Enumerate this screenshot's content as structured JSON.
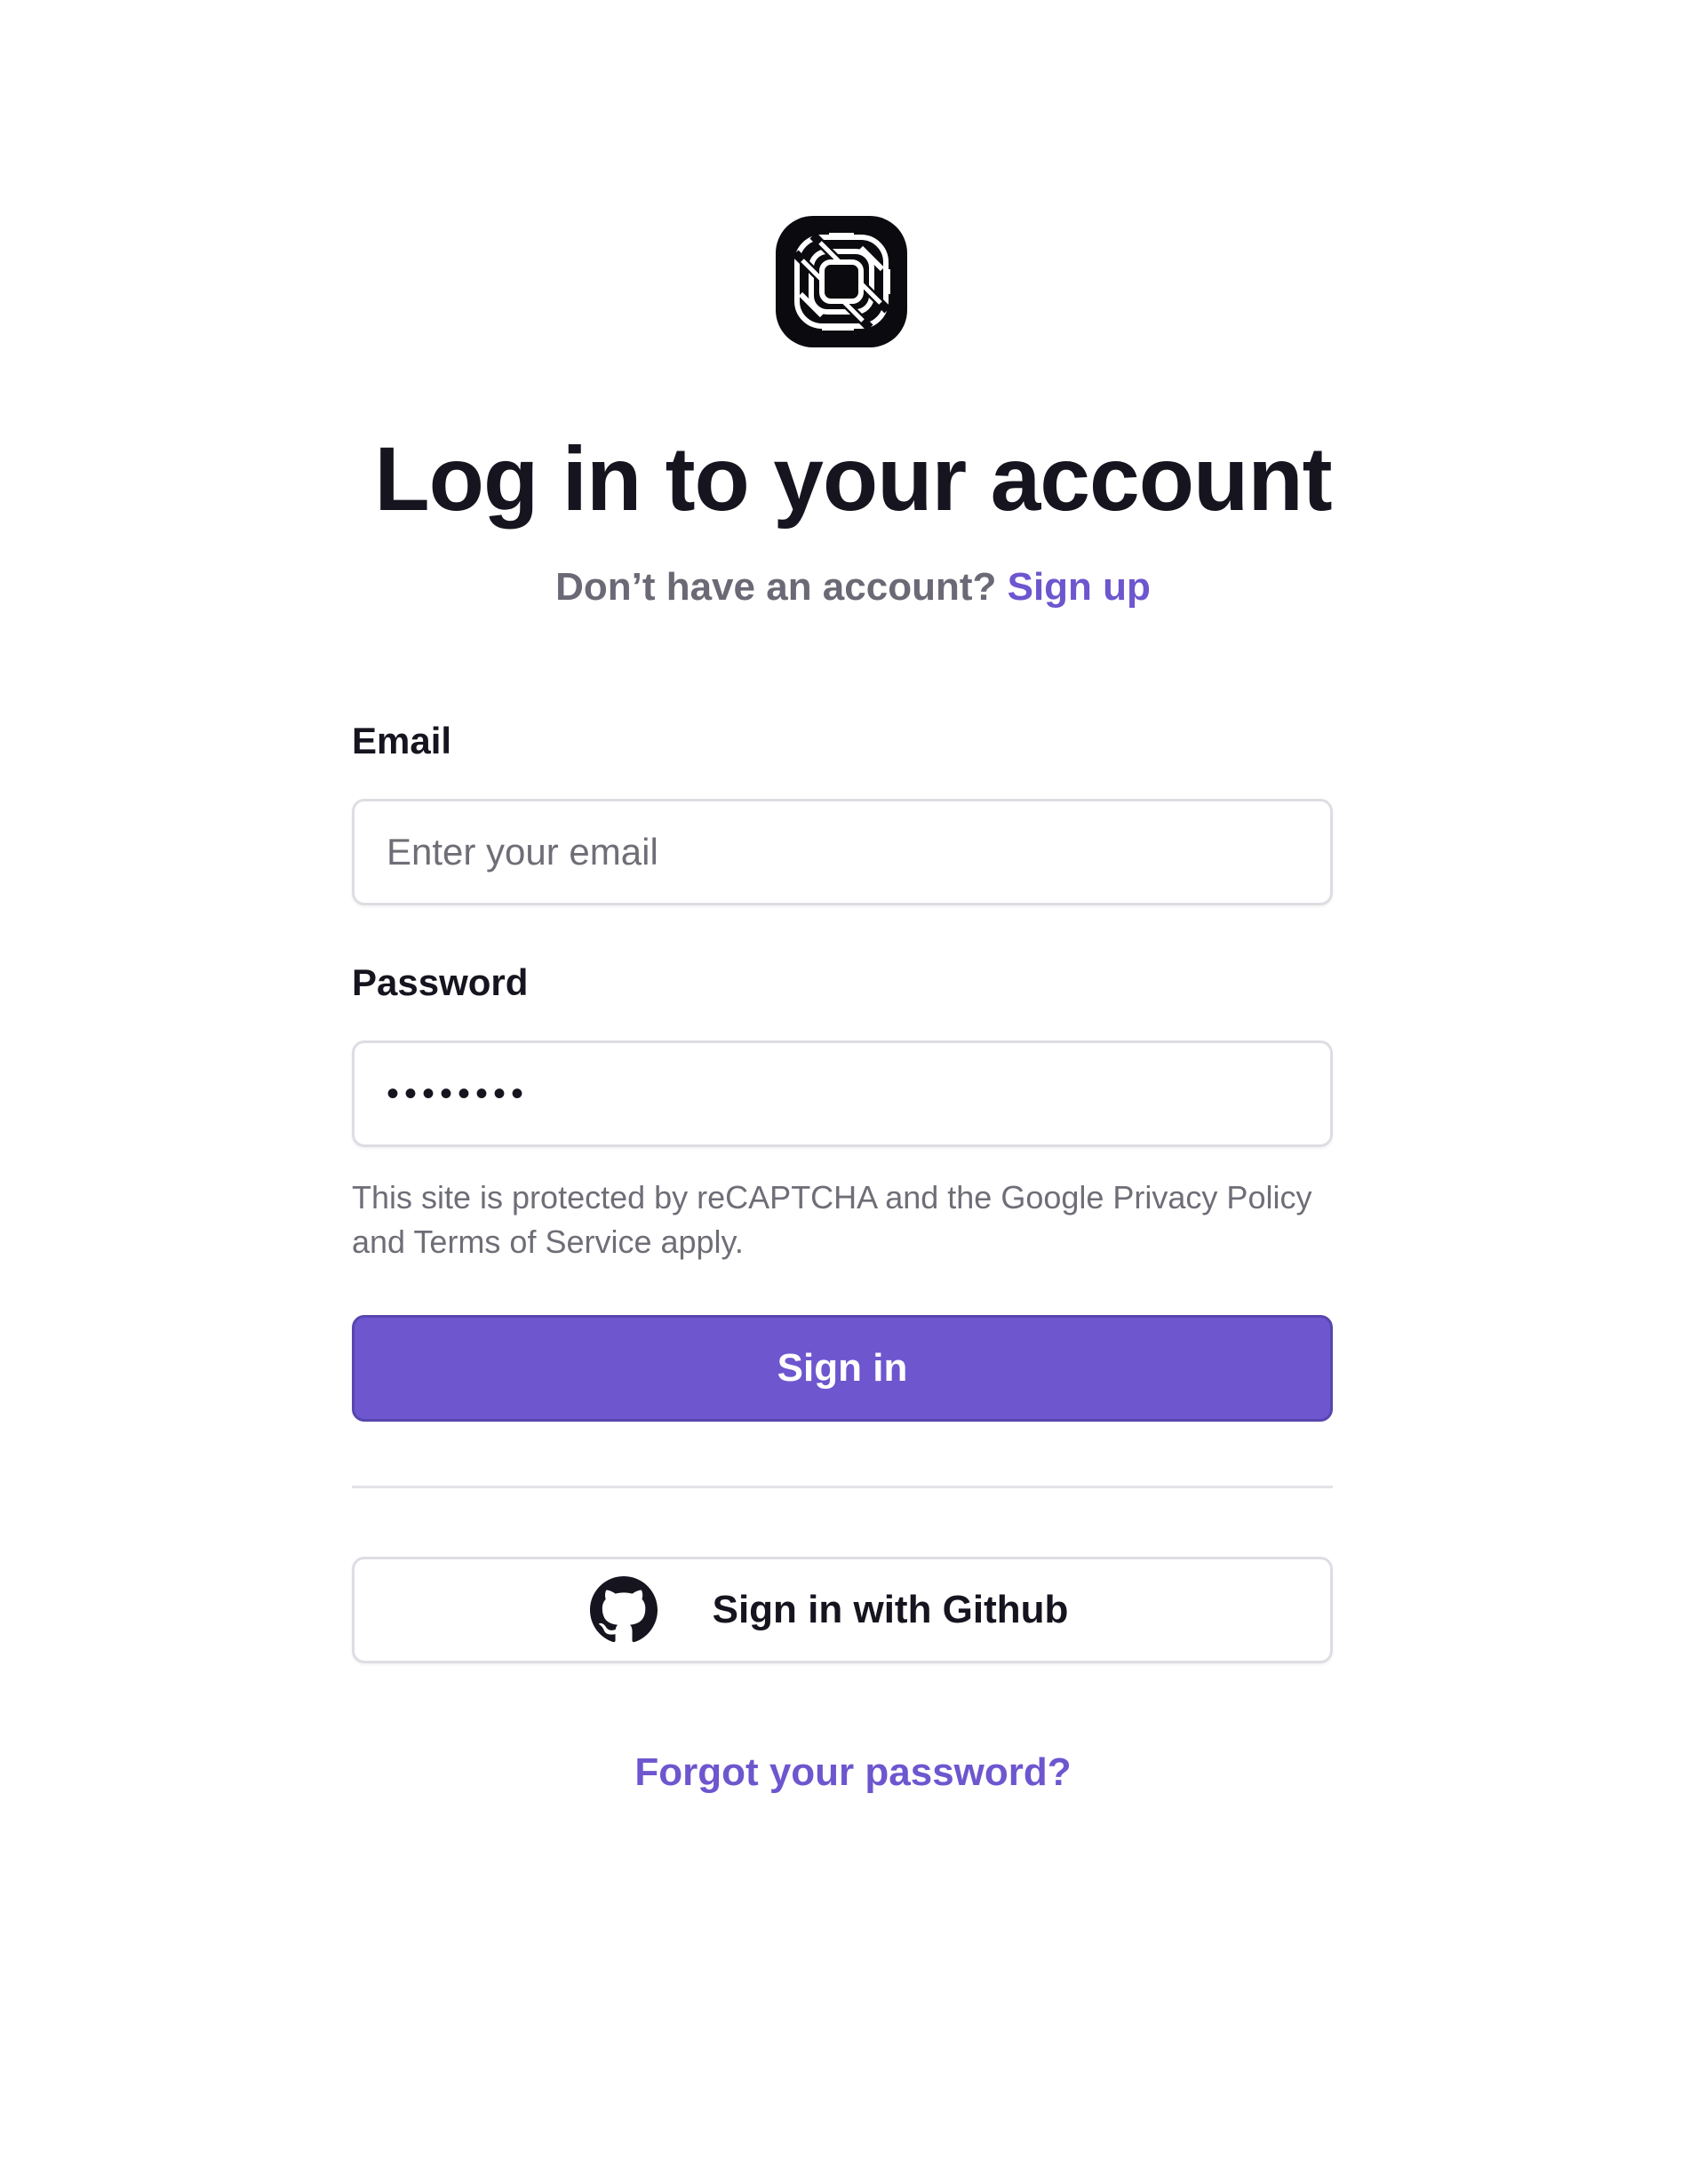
{
  "brand": {
    "logo_icon": "app-logo-icon"
  },
  "header": {
    "title": "Log in to your account",
    "subtitle_text": "Don’t have an account?",
    "signup_link": "Sign up"
  },
  "form": {
    "email": {
      "label": "Email",
      "placeholder": "Enter your email",
      "value": ""
    },
    "password": {
      "label": "Password",
      "value": "••••••••"
    },
    "recaptcha_note": "This site is protected by reCAPTCHA and the Google Privacy Policy and Terms of Service apply.",
    "submit_label": "Sign in"
  },
  "oauth": {
    "github_label": "Sign in with Github",
    "github_icon": "github-icon"
  },
  "footer": {
    "forgot_link": "Forgot your password?"
  },
  "colors": {
    "accent": "#6e56cf",
    "text": "#16151f",
    "muted": "#6f6e77",
    "border": "#dedde3"
  }
}
